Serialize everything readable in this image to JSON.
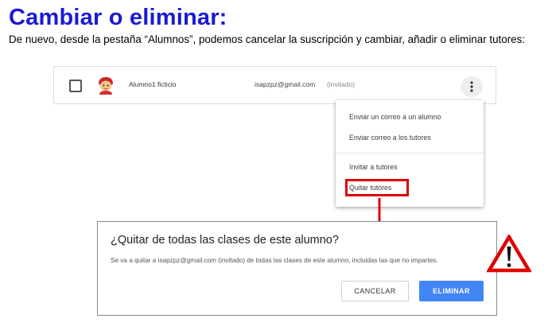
{
  "slide": {
    "title": "Cambiar o eliminar:",
    "description": "De nuevo, desde la pestaña “Alumnos”, podemos cancelar la suscripción y cambiar, añadir o eliminar tutores:"
  },
  "student_row": {
    "name": "Alumno1 ficticio",
    "email": "isapzpz@gmail.com",
    "status": "(invitado)",
    "checked": false,
    "more_icon": "more-vertical-icon"
  },
  "menu": {
    "items": [
      "Enviar un correo a un alumno",
      "Enviar correo a los tutores",
      "Invitar a tutores",
      "Quitar tutores"
    ],
    "highlighted_item": "Quitar tutores"
  },
  "dialog": {
    "title": "¿Quitar de todas las clases de este alumno?",
    "body": "Se va a quitar a isapzpz@gmail.com (invitado) de todas las clases de este alumno, incluidas las que no impartes.",
    "cancel_label": "CANCELAR",
    "confirm_label": "ELIMINAR"
  },
  "colors": {
    "title": "#1a1ad6",
    "highlight": "#e00000",
    "primary_button": "#4285f4"
  },
  "icons": {
    "warning": "warning-triangle-icon",
    "avatar": "student-avatar-icon",
    "arrow": "red-down-arrow"
  }
}
